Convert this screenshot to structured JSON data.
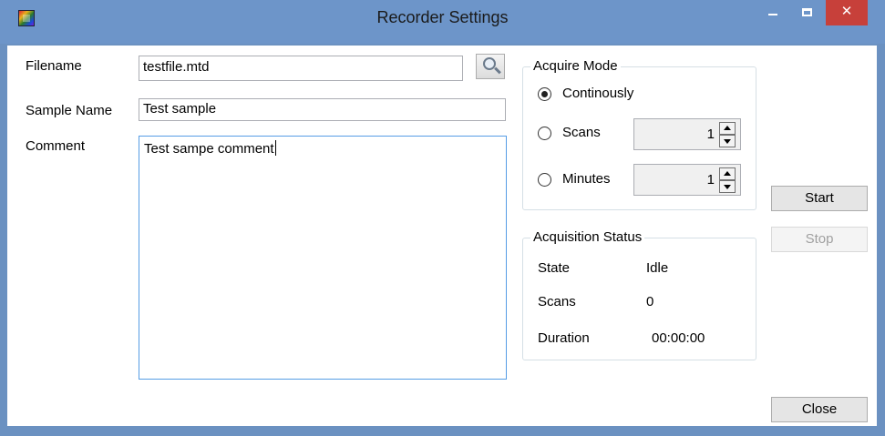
{
  "window": {
    "title": "Recorder Settings",
    "close_glyph": "✕"
  },
  "form": {
    "filename_label": "Filename",
    "filename_value": "testfile.mtd",
    "sample_name_label": "Sample Name",
    "sample_name_value": "Test sample",
    "comment_label": "Comment",
    "comment_value": "Test sampe comment"
  },
  "acquire_mode": {
    "title": "Acquire Mode",
    "options": [
      {
        "label": "Continously",
        "checked": true
      },
      {
        "label": "Scans",
        "checked": false,
        "value": "1"
      },
      {
        "label": "Minutes",
        "checked": false,
        "value": "1"
      }
    ]
  },
  "acquisition_status": {
    "title": "Acquisition Status",
    "rows": [
      {
        "label": "State",
        "value": "Idle"
      },
      {
        "label": "Scans",
        "value": "0"
      },
      {
        "label": "Duration",
        "value": "00:00:00"
      }
    ]
  },
  "buttons": {
    "start": "Start",
    "stop": "Stop",
    "close": "Close"
  },
  "colors": {
    "title_bar": "#6d95c9",
    "close_button": "#c7403a",
    "focus_border": "#569de5"
  },
  "icons": {
    "app": "app-icon",
    "browse": "magnifier-icon"
  }
}
